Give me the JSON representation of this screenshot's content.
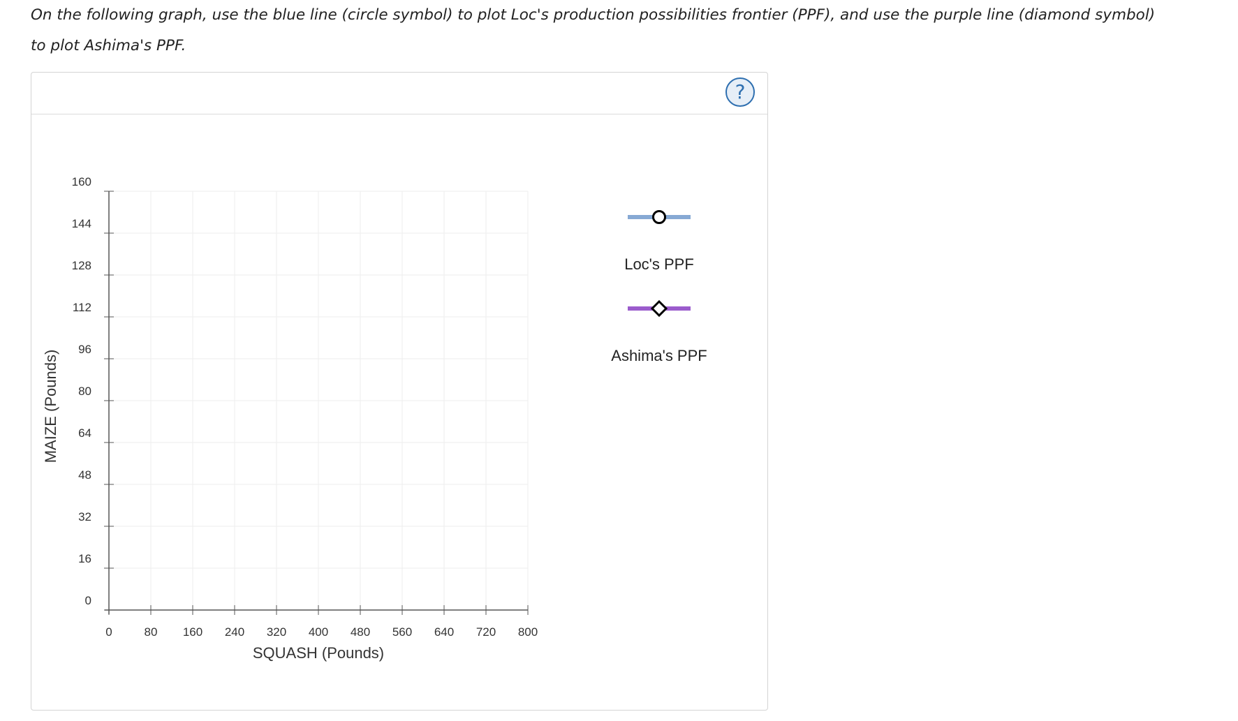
{
  "instructions": {
    "line1": "On the following graph, use the blue line (circle symbol) to plot Loc's production possibilities frontier (PPF), and use the purple line (diamond symbol)",
    "line2": "to plot Ashima's PPF."
  },
  "help": {
    "label": "?",
    "icon": "question-mark-icon"
  },
  "colors": {
    "loc": "#87a9d4",
    "ashima": "#9b5ccc",
    "grid": "#eeeeee",
    "axis": "#555555",
    "help": "#2e6fb0"
  },
  "legend": [
    {
      "id": "loc",
      "label": "Loc's PPF",
      "symbol": "circle",
      "icon": "circle-marker-icon"
    },
    {
      "id": "ashima",
      "label": "Ashima's PPF",
      "symbol": "diamond",
      "icon": "diamond-marker-icon"
    }
  ],
  "chart_data": {
    "type": "line",
    "xlabel": "SQUASH (Pounds)",
    "ylabel": "MAIZE (Pounds)",
    "xlim": [
      0,
      800
    ],
    "ylim": [
      0,
      160
    ],
    "xticks": [
      0,
      80,
      160,
      240,
      320,
      400,
      480,
      560,
      640,
      720,
      800
    ],
    "yticks": [
      0,
      16,
      32,
      48,
      64,
      80,
      96,
      112,
      128,
      144,
      160
    ],
    "grid": true,
    "legend_position": "right",
    "series": [
      {
        "name": "Loc's PPF",
        "symbol": "circle",
        "points": []
      },
      {
        "name": "Ashima's PPF",
        "symbol": "diamond",
        "points": []
      }
    ]
  }
}
